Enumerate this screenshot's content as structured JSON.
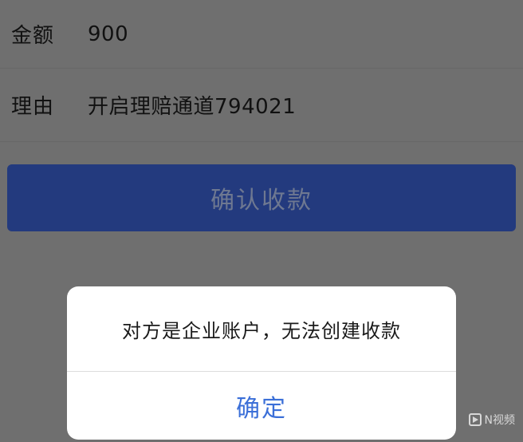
{
  "form": {
    "amount": {
      "label": "金额",
      "value": "900"
    },
    "reason": {
      "label": "理由",
      "value": "开启理赔通道794021"
    }
  },
  "confirm_button": {
    "label": "确认收款"
  },
  "dialog": {
    "message": "对方是企业账户，无法创建收款",
    "ok_label": "确定"
  },
  "watermark": {
    "text": "N视频"
  },
  "colors": {
    "overlay": "#6f6f6f",
    "button_bg": "#233a7e",
    "dialog_link": "#3b6fd8"
  }
}
